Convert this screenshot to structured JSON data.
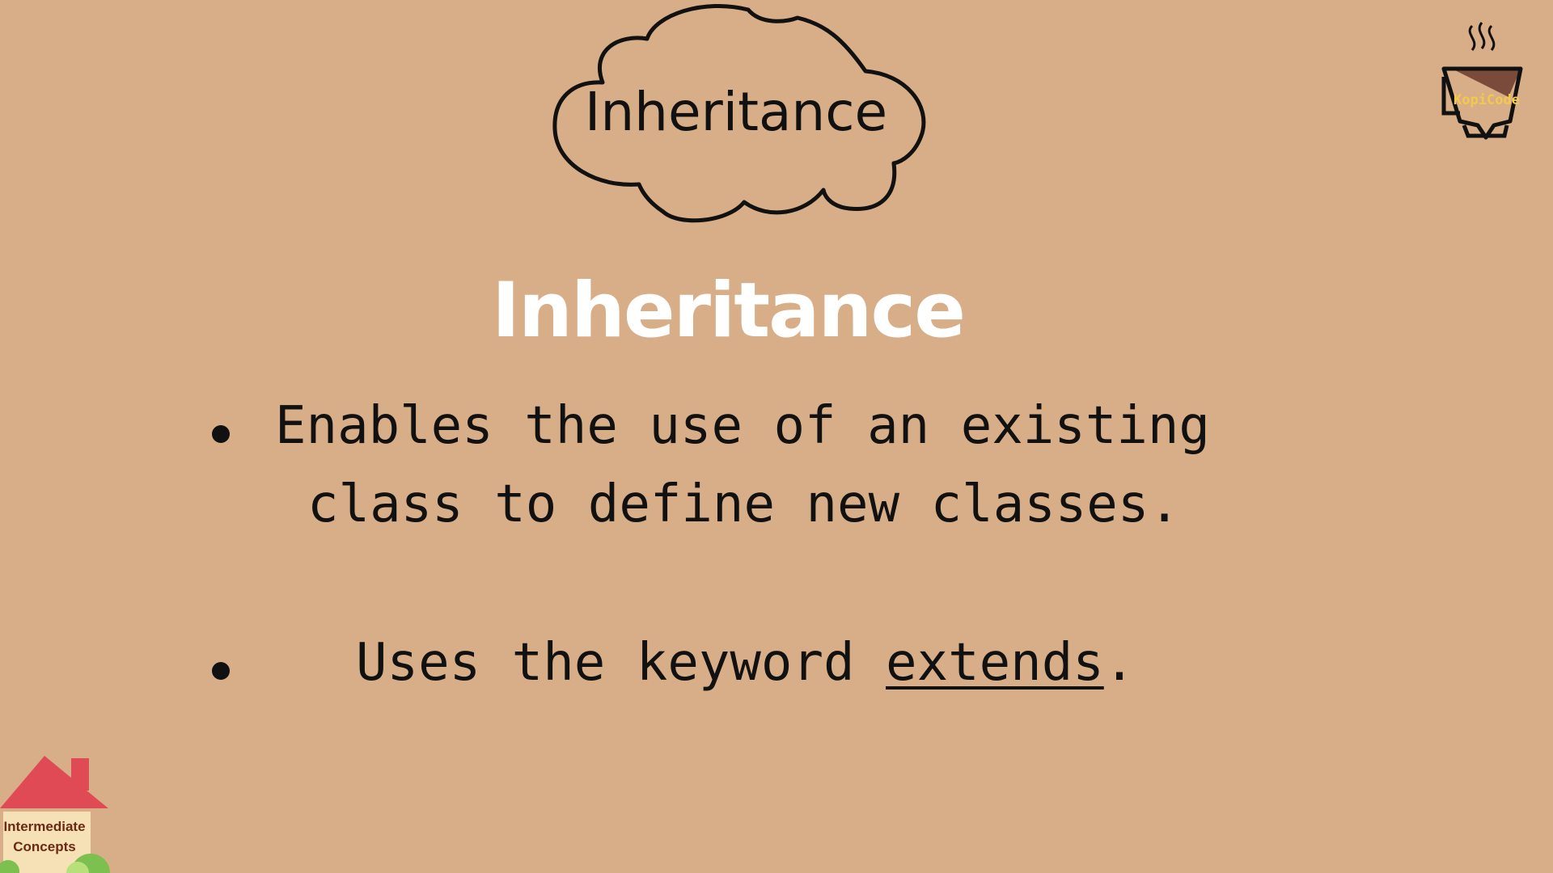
{
  "cloud": {
    "title": "Inheritance"
  },
  "slide": {
    "heading": "Inheritance",
    "bullet1_line1": "Enables the use of an existing",
    "bullet1_line2": "class to define new classes.",
    "bullet2_prefix": "Uses the keyword ",
    "bullet2_keyword": "extends",
    "bullet2_suffix": "."
  },
  "logo": {
    "text": "KopiCode",
    "icon": "coffee-cup-icon"
  },
  "badge": {
    "line1": "Intermediate",
    "line2": "Concepts",
    "icon": "house-icon"
  },
  "colors": {
    "background": "#d8ae88",
    "heading": "#ffffff",
    "text": "#111111",
    "house_roof": "#e04a55",
    "logo_text": "#f2c94c"
  }
}
